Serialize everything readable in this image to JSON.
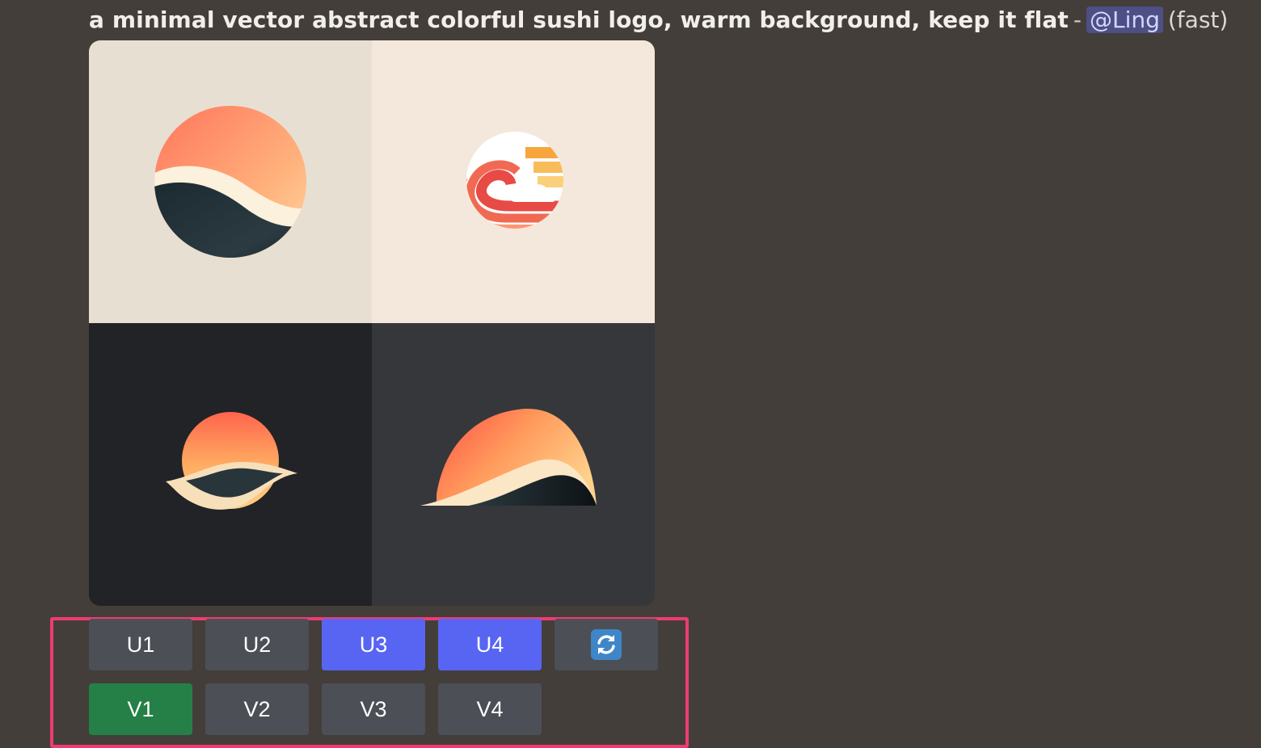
{
  "message": {
    "prompt": "a minimal vector abstract colorful sushi logo, warm background, keep it flat",
    "separator": "-",
    "mention": "@Ling",
    "speed": "(fast)"
  },
  "image_grid": {
    "tiles": [
      {
        "name": "variation-1",
        "background": "#e8dfd3"
      },
      {
        "name": "variation-2",
        "background": "#f3e8db"
      },
      {
        "name": "variation-3",
        "background": "#222326"
      },
      {
        "name": "variation-4",
        "background": "#36373b"
      }
    ]
  },
  "actions": {
    "upscale": [
      {
        "label": "U1",
        "color": "#4c4f56",
        "state": "default"
      },
      {
        "label": "U2",
        "color": "#4c4f56",
        "state": "default"
      },
      {
        "label": "U3",
        "color": "#5865f2",
        "state": "selected"
      },
      {
        "label": "U4",
        "color": "#5865f2",
        "state": "selected"
      }
    ],
    "reroll": {
      "icon": "refresh-icon",
      "color": "#4c4f56"
    },
    "variation": [
      {
        "label": "V1",
        "color": "#248046",
        "state": "selected"
      },
      {
        "label": "V2",
        "color": "#4c4f56",
        "state": "default"
      },
      {
        "label": "V3",
        "color": "#4c4f56",
        "state": "default"
      },
      {
        "label": "V4",
        "color": "#4c4f56",
        "state": "default"
      }
    ]
  },
  "highlight_color": "#ef3b72"
}
